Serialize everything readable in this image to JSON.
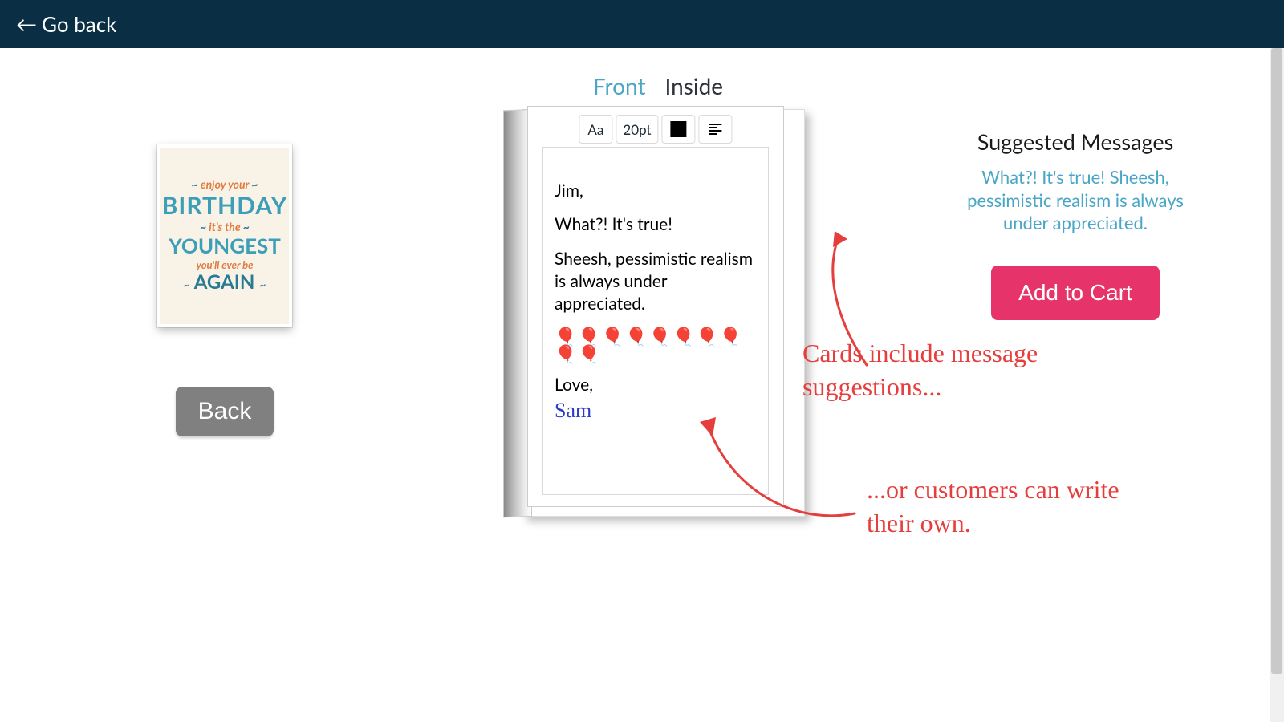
{
  "header": {
    "go_back_label": "Go back"
  },
  "tabs": {
    "front": "Front",
    "inside": "Inside",
    "active": "front"
  },
  "thumbnail": {
    "line1": "enjoy your",
    "line2": "BIRTHDAY",
    "line3": "it's the",
    "line4": "YOUNGEST",
    "line5": "you'll ever be",
    "line6": "AGAIN"
  },
  "left": {
    "back_label": "Back"
  },
  "toolbar": {
    "font_btn": "Aa",
    "size_btn": "20pt",
    "color_hex": "#000000",
    "align": "left"
  },
  "message": {
    "greeting": "Jim,",
    "line1": "What?! It's true!",
    "line2": "Sheesh, pessimistic realism is always under appreciated.",
    "balloons": "🎈🎈🎈🎈🎈🎈🎈🎈🎈🎈",
    "closing": "Love,",
    "signature": "Sam"
  },
  "right": {
    "title": "Suggested Messages",
    "suggestion": "What?! It's true! Sheesh, pessimistic realism is always under appreciated.",
    "add_to_cart": "Add to Cart"
  },
  "annotations": {
    "a1": "Cards include message suggestions...",
    "a2": "...or customers can write their own."
  }
}
